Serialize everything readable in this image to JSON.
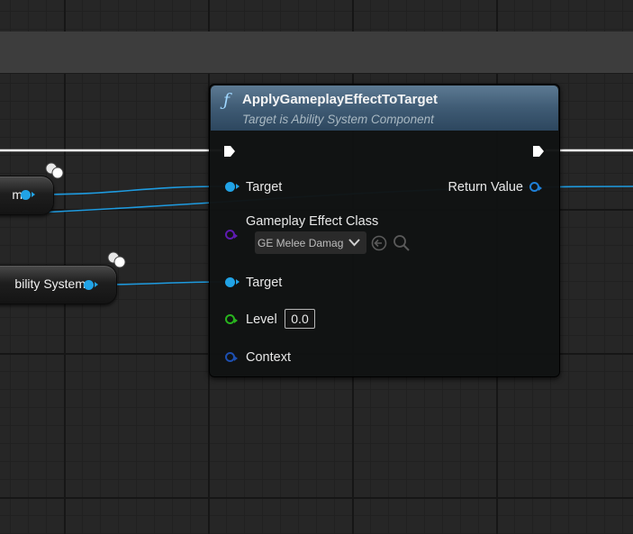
{
  "node": {
    "glyph": "ƒ",
    "title": "ApplyGameplayEffectToTarget",
    "subtitle": "Target is Ability System Component",
    "pins": {
      "target_1": "Target",
      "return_value": "Return Value",
      "effect_class_label": "Gameplay Effect Class",
      "effect_class_value": "GE Melee Damage",
      "target_2": "Target",
      "level_label": "Level",
      "level_value": "0.0",
      "context_label": "Context"
    },
    "icons": [
      "function-icon",
      "exec-in-icon",
      "exec-out-icon",
      "chevron-down-icon",
      "use-selected-icon",
      "browse-icon"
    ]
  },
  "left_nodes": {
    "node_a_label": "m",
    "node_b_label": "bility System"
  },
  "colors": {
    "object_pin": "#21a3e6",
    "class_pin": "#5e1bb0",
    "float_pin": "#28b41e",
    "struct_pin": "#1d4fb0",
    "wire": "#1e9be0",
    "exec_wire": "#ffffff",
    "header": "#4a6680"
  }
}
